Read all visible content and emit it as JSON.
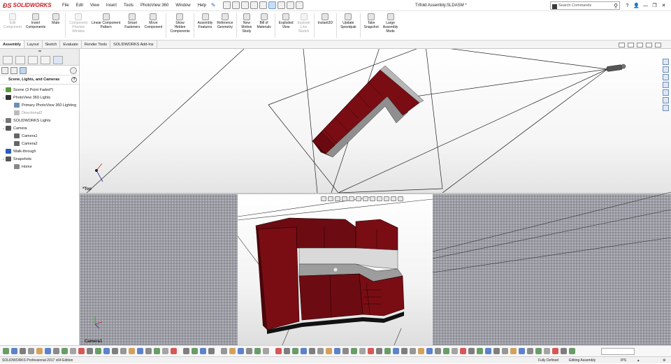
{
  "app": {
    "logo_text": "SOLIDWORKS",
    "window_title": "Trifold Assembly.SLDASM *"
  },
  "menu": [
    "File",
    "Edit",
    "View",
    "Insert",
    "Tools",
    "PhotoView 360",
    "Window",
    "Help"
  ],
  "search": {
    "label": "Search Commands",
    "help": "?"
  },
  "ribbon": [
    {
      "label": "Edit\nComponent",
      "icon": "edit-component-icon",
      "enabled": false
    },
    {
      "label": "Insert\nComponents",
      "icon": "insert-components-icon",
      "enabled": true
    },
    {
      "label": "Mate",
      "icon": "mate-icon",
      "enabled": true
    },
    {
      "label": "Component\nPreview\nWindow",
      "icon": "component-preview-icon",
      "enabled": false
    },
    {
      "label": "Linear Component\nPattern",
      "icon": "linear-pattern-icon",
      "enabled": true
    },
    {
      "label": "Smart\nFasteners",
      "icon": "smart-fasteners-icon",
      "enabled": true
    },
    {
      "label": "Move\nComponent",
      "icon": "move-component-icon",
      "enabled": true
    },
    {
      "label": "Show\nHidden\nComponents",
      "icon": "show-hidden-icon",
      "enabled": true
    },
    {
      "label": "Assembly\nFeatures",
      "icon": "assembly-features-icon",
      "enabled": true
    },
    {
      "label": "Reference\nGeometry",
      "icon": "reference-geometry-icon",
      "enabled": true
    },
    {
      "label": "New\nMotion\nStudy",
      "icon": "motion-study-icon",
      "enabled": true
    },
    {
      "label": "Bill of\nMaterials",
      "icon": "bom-icon",
      "enabled": true
    },
    {
      "label": "Exploded\nView",
      "icon": "exploded-view-icon",
      "enabled": true
    },
    {
      "label": "Explode\nLine\nSketch",
      "icon": "explode-line-icon",
      "enabled": false
    },
    {
      "label": "Instant3D",
      "icon": "instant3d-icon",
      "enabled": true
    },
    {
      "label": "Update\nSpeedpak",
      "icon": "speedpak-icon",
      "enabled": true
    },
    {
      "label": "Take\nSnapshot",
      "icon": "snapshot-icon",
      "enabled": true
    },
    {
      "label": "Large\nAssembly\nMode",
      "icon": "large-assembly-icon",
      "enabled": true
    }
  ],
  "tabs": [
    "Assembly",
    "Layout",
    "Sketch",
    "Evaluate",
    "Render Tools",
    "SOLIDWORKS Add-Ins"
  ],
  "active_tab": "Assembly",
  "panel": {
    "title": "Scene, Lights, and Cameras",
    "help": "?",
    "tree": [
      {
        "label": "Scene (3 Point Faded*)",
        "indent": 0,
        "toggle": "›",
        "icon_color": "#5a9a3c",
        "dim": false
      },
      {
        "label": "PhotoView 360 Lights",
        "indent": 0,
        "toggle": "⌄",
        "icon_color": "#333333",
        "dim": false
      },
      {
        "label": "Primary PhotoView 360 Lighting",
        "indent": 1,
        "toggle": "",
        "icon_color": "#6b8fb5",
        "dim": false
      },
      {
        "label": "Directional2",
        "indent": 1,
        "toggle": "",
        "icon_color": "#bbbbbb",
        "dim": true
      },
      {
        "label": "SOLIDWORKS Lights",
        "indent": 0,
        "toggle": "›",
        "icon_color": "#777777",
        "dim": false
      },
      {
        "label": "Camera",
        "indent": 0,
        "toggle": "⌄",
        "icon_color": "#555555",
        "dim": false
      },
      {
        "label": "Camera1",
        "indent": 1,
        "toggle": "",
        "icon_color": "#666666",
        "dim": false
      },
      {
        "label": "Camera2",
        "indent": 1,
        "toggle": "",
        "icon_color": "#666666",
        "dim": false
      },
      {
        "label": "Walk-through",
        "indent": 0,
        "toggle": "",
        "icon_color": "#2a5bbf",
        "dim": false
      },
      {
        "label": "Snapshots",
        "indent": 0,
        "toggle": "⌄",
        "icon_color": "#555555",
        "dim": false
      },
      {
        "label": "Home",
        "indent": 1,
        "toggle": "",
        "icon_color": "#888888",
        "dim": false
      }
    ]
  },
  "viewports": {
    "top_label": "*Top",
    "bottom_label": "Camera1"
  },
  "status": {
    "edition": "SOLIDWORKS Professional 2017 x64 Edition",
    "defined": "Fully Defined",
    "mode": "Editing Assembly",
    "units": "IPS"
  },
  "colors": {
    "cabinet": "#7a0d14",
    "cabinet_dark": "#4a0609",
    "countertop": "#9d9d9d",
    "accent": "#cc2027"
  }
}
